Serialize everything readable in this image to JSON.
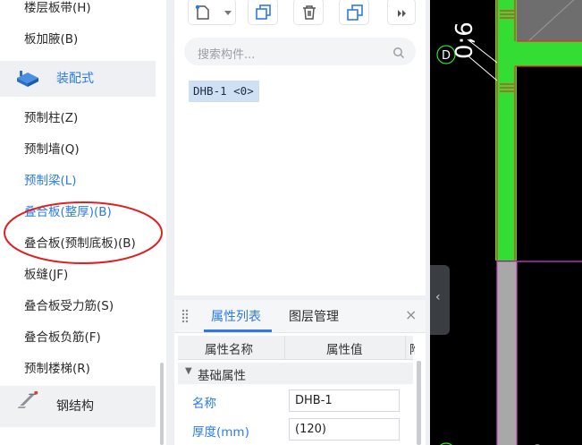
{
  "nav": {
    "items_top": [
      {
        "label": "楼层板带(H)"
      },
      {
        "label": "板加腋(B)"
      }
    ],
    "category_prefab": {
      "label": "装配式",
      "icon": "prefab-stack-icon"
    },
    "items_prefab": [
      {
        "label": "预制柱(Z)"
      },
      {
        "label": "预制墙(Q)"
      },
      {
        "label": "预制梁(L)"
      },
      {
        "label": "叠合板(整厚)(B)"
      },
      {
        "label": "叠合板(预制底板)(B)"
      },
      {
        "label": "板缝(JF)"
      },
      {
        "label": "叠合板受力筋(S)"
      },
      {
        "label": "叠合板负筋(F)"
      },
      {
        "label": "预制楼梯(R)"
      }
    ],
    "category_steel": {
      "label": "钢结构",
      "icon": "steel-beam-icon",
      "badge_color": "#e53935"
    },
    "active_index": 2,
    "annotation_color": "#e02020"
  },
  "component_panel": {
    "toolbar": {
      "new_icon": "new-component-icon",
      "dropdown_icon": "chevron-down-icon",
      "copy_icon": "copy-icon",
      "delete_icon": "delete-icon",
      "layer_copy_icon": "layer-copy-icon",
      "more_icon": "double-chevron-right-icon"
    },
    "search": {
      "placeholder": "搜索构件..."
    },
    "items": [
      {
        "label": "DHB-1 <0>"
      }
    ]
  },
  "properties": {
    "tabs": [
      {
        "label": "属性列表"
      },
      {
        "label": "图层管理"
      }
    ],
    "close_symbol": "×",
    "columns": [
      "属性名称",
      "属性值",
      "附"
    ],
    "group": "基础属性",
    "rows": [
      {
        "name": "名称",
        "value": "DHB-1"
      },
      {
        "name": "厚度(mm)",
        "value": "(120)"
      }
    ]
  },
  "canvas": {
    "label": "0;6",
    "axis_tag": "D",
    "collapse_symbol": "‹",
    "colors": {
      "wall": "#33dd33",
      "edge": "#ff2222",
      "slab": "#a8a8a8",
      "outline": "#cc44cc",
      "bg": "#000000"
    }
  },
  "accent_color": "#2c7be5"
}
